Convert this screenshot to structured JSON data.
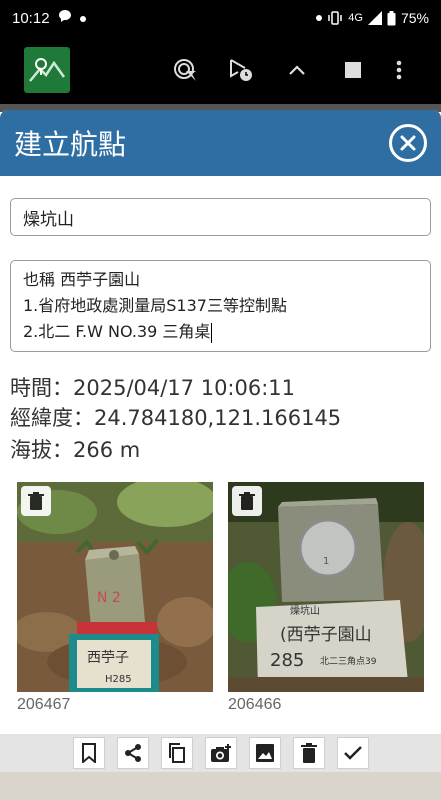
{
  "status_bar": {
    "time": "10:12",
    "network": "4G",
    "battery": "75%",
    "icons": [
      "chat-bubble-icon",
      "dot-icon",
      "dot-icon",
      "vibrate-icon",
      "signal-icon",
      "battery-icon"
    ]
  },
  "app_bar": {
    "icons": [
      "app-logo-icon",
      "gps-locate-icon",
      "route-timer-icon",
      "chevron-up-icon",
      "stop-icon",
      "more-vert-icon"
    ]
  },
  "dialog": {
    "title": "建立航點",
    "name_value": "燥坑山",
    "description_lines": [
      "也稱 西苧子園山",
      "1.省府地政處測量局S137三等控制點",
      "2.北二 F.W NO.39 三角桌"
    ],
    "time_line": "時間：2025/04/17 10:06:11",
    "coordinate_line": "經緯度：24.784180,121.166145",
    "altitude_line": "海拔：266 m",
    "photos": [
      {
        "id": "206467"
      },
      {
        "id": "206466"
      }
    ]
  },
  "toolbar": {
    "buttons": [
      "bookmark-icon",
      "share-icon",
      "copy-icon",
      "add-photo-icon",
      "gallery-icon",
      "delete-icon",
      "confirm-check-icon"
    ]
  },
  "colors": {
    "header": "#2e6ea3",
    "app_logo": "#1f7a3a",
    "toolbar": "#e4e4e4"
  }
}
